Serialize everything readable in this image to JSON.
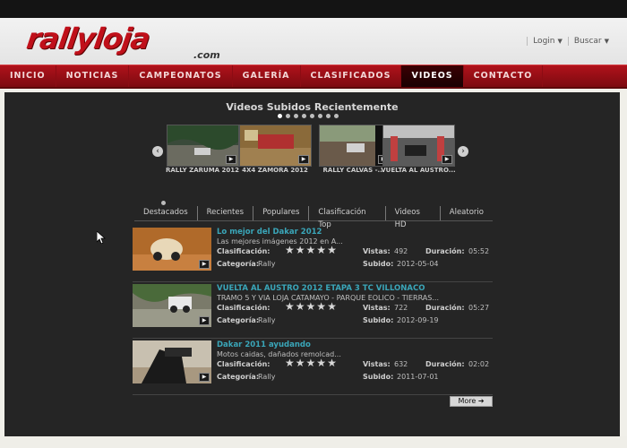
{
  "header": {
    "logo_main": "rallyloja",
    "logo_sub": ".com",
    "links": [
      {
        "label": "Login"
      },
      {
        "label": "Buscar"
      }
    ]
  },
  "nav": {
    "items": [
      {
        "label": "INICIO"
      },
      {
        "label": "NOTICIAS"
      },
      {
        "label": "CAMPEONATOS"
      },
      {
        "label": "GALERÍA"
      },
      {
        "label": "CLASIFICADOS"
      },
      {
        "label": "VIDEOS",
        "active": true
      },
      {
        "label": "CONTACTO"
      }
    ]
  },
  "carousel": {
    "title": "Videos Subidos Recientemente",
    "dot_count": 8,
    "active_dot": 0,
    "items": [
      {
        "caption": "RALLY ZARUMA 2012"
      },
      {
        "caption": "4X4 ZAMORA 2012"
      },
      {
        "caption": "RALLY CALVAS -..."
      },
      {
        "caption": "VUELTA AL AUSTRO..."
      }
    ]
  },
  "tabs": [
    {
      "label": "Destacados"
    },
    {
      "label": "Recientes"
    },
    {
      "label": "Populares"
    },
    {
      "label": "Clasificación Top"
    },
    {
      "label": "Videos HD"
    },
    {
      "label": "Aleatorio"
    }
  ],
  "labels": {
    "rating": "Clasificación:",
    "category": "Categoría:",
    "views": "Vistas:",
    "duration": "Duración:",
    "uploaded": "Subido:"
  },
  "videos": [
    {
      "title": "Lo mejor del Dakar 2012",
      "desc": "Las mejores imágenes 2012 en A...",
      "category": "Rally",
      "views": "492",
      "duration": "05:52",
      "uploaded": "2012-05-04"
    },
    {
      "title": "VUELTA AL AUSTRO 2012 ETAPA 3 TC VILLONACO",
      "desc": "TRAMO 5 Y VIA LOJA CATAMAYO - PARQUE EOLICO - TIERRAS...",
      "category": "Rally",
      "views": "722",
      "duration": "05:27",
      "uploaded": "2012-09-19"
    },
    {
      "title": "Dakar 2011 ayudando",
      "desc": "Motos caidas, dañados remolcad...",
      "category": "Rally",
      "views": "632",
      "duration": "02:02",
      "uploaded": "2011-07-01"
    }
  ],
  "more_label": "More ➔",
  "icons": {
    "prev": "chevron-left-icon",
    "next": "chevron-right-icon",
    "play": "play-icon",
    "star": "star-icon"
  }
}
